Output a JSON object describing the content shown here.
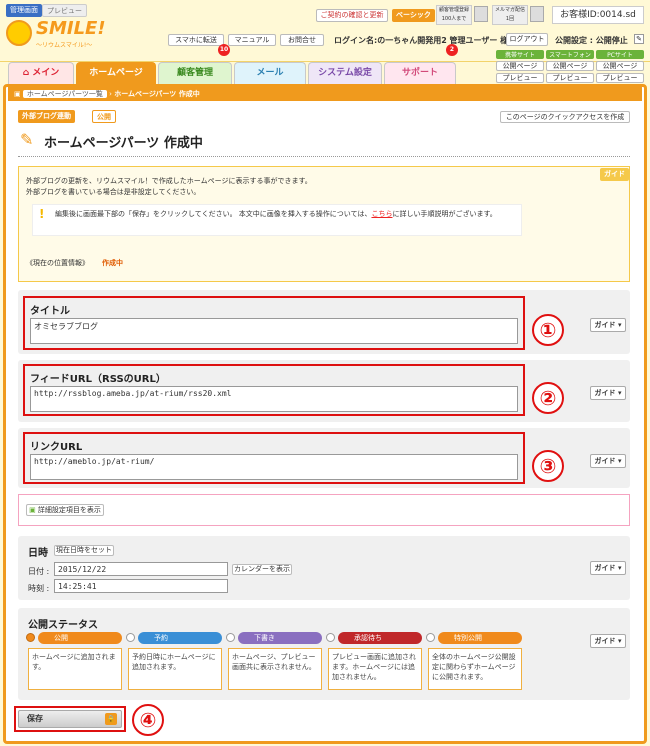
{
  "header": {
    "admin_tag": "管理画面",
    "preview_tag": "プレビュー",
    "logo_text": "SMILE!",
    "logo_sub": "〜リウムスマイル!〜",
    "contract_link": "ご契約の確認と更新",
    "plan_badge": "ベーシック",
    "member_label": "顧客管理登録",
    "member_value": "100人まで",
    "mail_label": "メルマガ配信",
    "mail_value": "1回",
    "customer_id": "お客様ID:0014.sd",
    "sp_link": "スマホに転送",
    "manual_link": "マニュアル",
    "contact_link": "お問合せ",
    "login_text": "ログイン名:の一ちゃん開発用2 管理ユーザー 様",
    "logout_label": "ログアウト",
    "publish_setting": "公開設定 : 公開停止",
    "badge_count_1": "10",
    "badge_count_2": "2"
  },
  "tabs": [
    "メイン",
    "ホームページ",
    "顧客管理",
    "メール",
    "システム設定",
    "サポート"
  ],
  "sites": [
    {
      "name": "携帯サイト",
      "btn1": "公開ページ",
      "btn2": "プレビュー"
    },
    {
      "name": "スマートフォン",
      "btn1": "公開ページ",
      "btn2": "プレビュー"
    },
    {
      "name": "PCサイト",
      "btn1": "公開ページ",
      "btn2": "プレビュー"
    }
  ],
  "breadcrumb": {
    "parent": "ホームページパーツ一覧",
    "current": "ホームページパーツ 作成中"
  },
  "tags": {
    "external": "外部ブログ連動",
    "public": "公開"
  },
  "quick_access": "このページのクイックアクセスを作成",
  "page_title": "ホームページパーツ 作成中",
  "guide_box": {
    "label": "ガイド",
    "line1": "外部ブログの更新を、リウムスマイル！で作成したホームページに表示する事ができます。",
    "line2": "外部ブログを書いている場合は是非設定してください。",
    "warn_prefix": "編集後に画面最下部の「保存」をクリックしてください。 本文中に画像を挿入する操作については、",
    "warn_link": "こちら",
    "warn_suffix": "に詳しい手順説明がございます。",
    "location_label": "《現在の位置情報》",
    "location_value": "作成中"
  },
  "fields": {
    "title": {
      "label": "タイトル",
      "value": "オミセラブブログ"
    },
    "feed": {
      "label": "フィードURL（RSSのURL）",
      "value": "http://rssblog.ameba.jp/at-rium/rss20.xml"
    },
    "link": {
      "label": "リンクURL",
      "value": "http://ameblo.jp/at-rium/"
    }
  },
  "guide_button": "ガイド",
  "markers": [
    "①",
    "②",
    "③",
    "④"
  ],
  "advanced_button": "詳細設定項目を表示",
  "datetime": {
    "label": "日時",
    "now_button": "現在日時をセット",
    "date_label": "日付 :",
    "date_value": "2015/12/22",
    "calendar_button": "カレンダーを表示",
    "time_label": "時刻 :",
    "time_value": "14:25:41"
  },
  "status": {
    "label": "公開ステータス",
    "options": [
      {
        "name": "公開",
        "color": "#f08a1c",
        "desc": "ホームページに追加されます。"
      },
      {
        "name": "予約",
        "color": "#3a8fd6",
        "desc": "予約日時にホームページに追加されます。"
      },
      {
        "name": "下書き",
        "color": "#8a6fc0",
        "desc": "ホームページ、プレビュー画面共に表示されません。"
      },
      {
        "name": "承認待ち",
        "color": "#c0282a",
        "desc": "プレビュー画面に追加されます。ホームページには追加されません。"
      },
      {
        "name": "特別公開",
        "color": "#f08a1c",
        "desc": "全体のホームページ公開設定に関わらずホームページに公開されます。"
      }
    ]
  },
  "save_button": "保存",
  "colors": {
    "accent": "#f09a1d",
    "marker": "#e01010"
  }
}
